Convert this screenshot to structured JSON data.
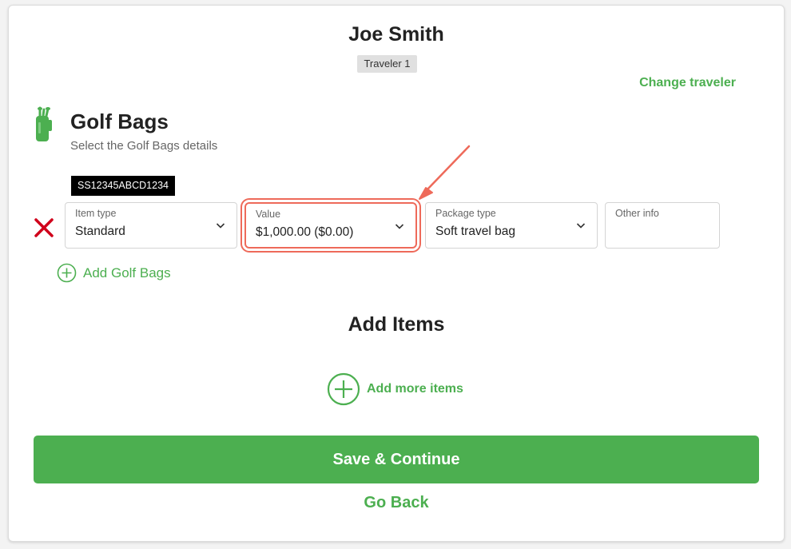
{
  "traveler": {
    "name": "Joe Smith",
    "badge": "Traveler 1",
    "change_label": "Change traveler"
  },
  "section": {
    "icon": "golf-bag-icon",
    "title": "Golf Bags",
    "subtitle": "Select the Golf Bags details"
  },
  "item": {
    "code": "SS12345ABCD1234",
    "fields": [
      {
        "label": "Item type",
        "value": "Standard"
      },
      {
        "label": "Value",
        "value": "$1,000.00 ($0.00)"
      },
      {
        "label": "Package type",
        "value": "Soft travel bag"
      },
      {
        "label": "Other info",
        "value": ""
      }
    ]
  },
  "add_bags_label": "Add Golf Bags",
  "add_items": {
    "title": "Add Items",
    "add_more_label": "Add more items"
  },
  "buttons": {
    "save": "Save & Continue",
    "back": "Go Back"
  },
  "colors": {
    "accent": "#4caf50",
    "remove": "#d0021b",
    "highlight": "#ee6a5a"
  }
}
